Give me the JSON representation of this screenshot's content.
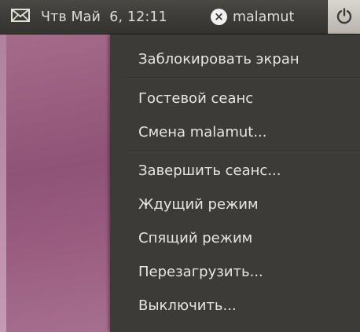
{
  "panel": {
    "clock_text": "Чтв Май  6, 12:11",
    "user_name": "malamut",
    "status_icon_glyph": "×"
  },
  "icons": {
    "mail": "envelope-icon",
    "status": "busy-status-icon",
    "session": "power-icon"
  },
  "session_menu": {
    "items": [
      {
        "label": "Заблокировать экран"
      },
      {
        "label": "Гостевой сеанс"
      },
      {
        "label": "Смена malamut..."
      },
      {
        "label": "Завершить сеанс..."
      },
      {
        "label": "Ждущий режим"
      },
      {
        "label": "Спящий режим"
      },
      {
        "label": "Перезагрузить..."
      },
      {
        "label": "Выключить..."
      }
    ]
  },
  "colors": {
    "panel_background": "#3c3b37",
    "menu_background": "#3c3b37",
    "menu_text": "#e8e6e1",
    "desktop_background": "#8f5377"
  }
}
